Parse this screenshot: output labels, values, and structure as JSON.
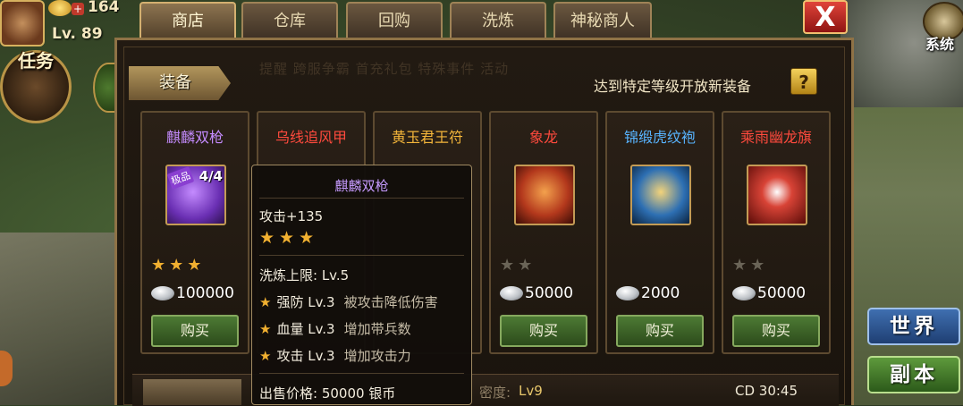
{
  "hud": {
    "gold_plus": "+",
    "gold_amount": "164",
    "level": "Lv. 89",
    "task_label": "任务",
    "system_label": "系统"
  },
  "tabs": [
    {
      "label": "商店",
      "active": true
    },
    {
      "label": "仓库",
      "active": false
    },
    {
      "label": "回购",
      "active": false
    },
    {
      "label": "洗炼",
      "active": false
    },
    {
      "label": "神秘商人",
      "active": false
    }
  ],
  "close_label": "X",
  "background_text": "提醒  跨服争霸  首充礼包  特殊事件      活动",
  "shop": {
    "category": "装备",
    "unlock_tip": "达到特定等级开放新装备",
    "help_label": "?",
    "buy_label": "购买",
    "items": [
      {
        "name": "麒麟双枪",
        "name_color": "#c58cff",
        "stars": 3,
        "star_color": "#f1b030",
        "price": "100000",
        "icon": "twin-spear-icon",
        "tier_badge": "极品",
        "count": "4/4"
      },
      {
        "name": "乌线追风甲",
        "name_color": "#ff4a3d",
        "stars": 0,
        "star_color": "#f1b030",
        "price": "",
        "icon": "armor-icon"
      },
      {
        "name": "黄玉君王符",
        "name_color": "#f3b53a",
        "stars": 0,
        "star_color": "#f1b030",
        "price": "",
        "icon": "talisman-icon"
      },
      {
        "name": "象龙",
        "name_color": "#ff4a3d",
        "stars": 2,
        "star_color": "#6a6457",
        "price": "50000",
        "icon": "horse-icon"
      },
      {
        "name": "锦缎虎纹袍",
        "name_color": "#58b4ff",
        "stars": 0,
        "star_color": "#6a6457",
        "price": "2000",
        "icon": "robe-icon"
      },
      {
        "name": "乘雨幽龙旗",
        "name_color": "#ff4a3d",
        "stars": 2,
        "star_color": "#6a6457",
        "price": "50000",
        "icon": "war-flag-icon"
      }
    ]
  },
  "tooltip": {
    "title": "麒麟双枪",
    "attack": "攻击+135",
    "stars": "★★★",
    "refine_limit": "洗炼上限: Lv.5",
    "skills": [
      {
        "name": "强防 Lv.3",
        "desc": "被攻击降低伤害"
      },
      {
        "name": "血量 Lv.3",
        "desc": "增加带兵数"
      },
      {
        "name": "攻击 Lv.3",
        "desc": "增加攻击力"
      }
    ],
    "sell_price": "出售价格: 50000 银币"
  },
  "bottom": {
    "density_label": "密度:",
    "density_value": "Lv9",
    "cooldown": "CD 30:45"
  },
  "side_buttons": {
    "world": "世界",
    "dungeon": "副本"
  }
}
